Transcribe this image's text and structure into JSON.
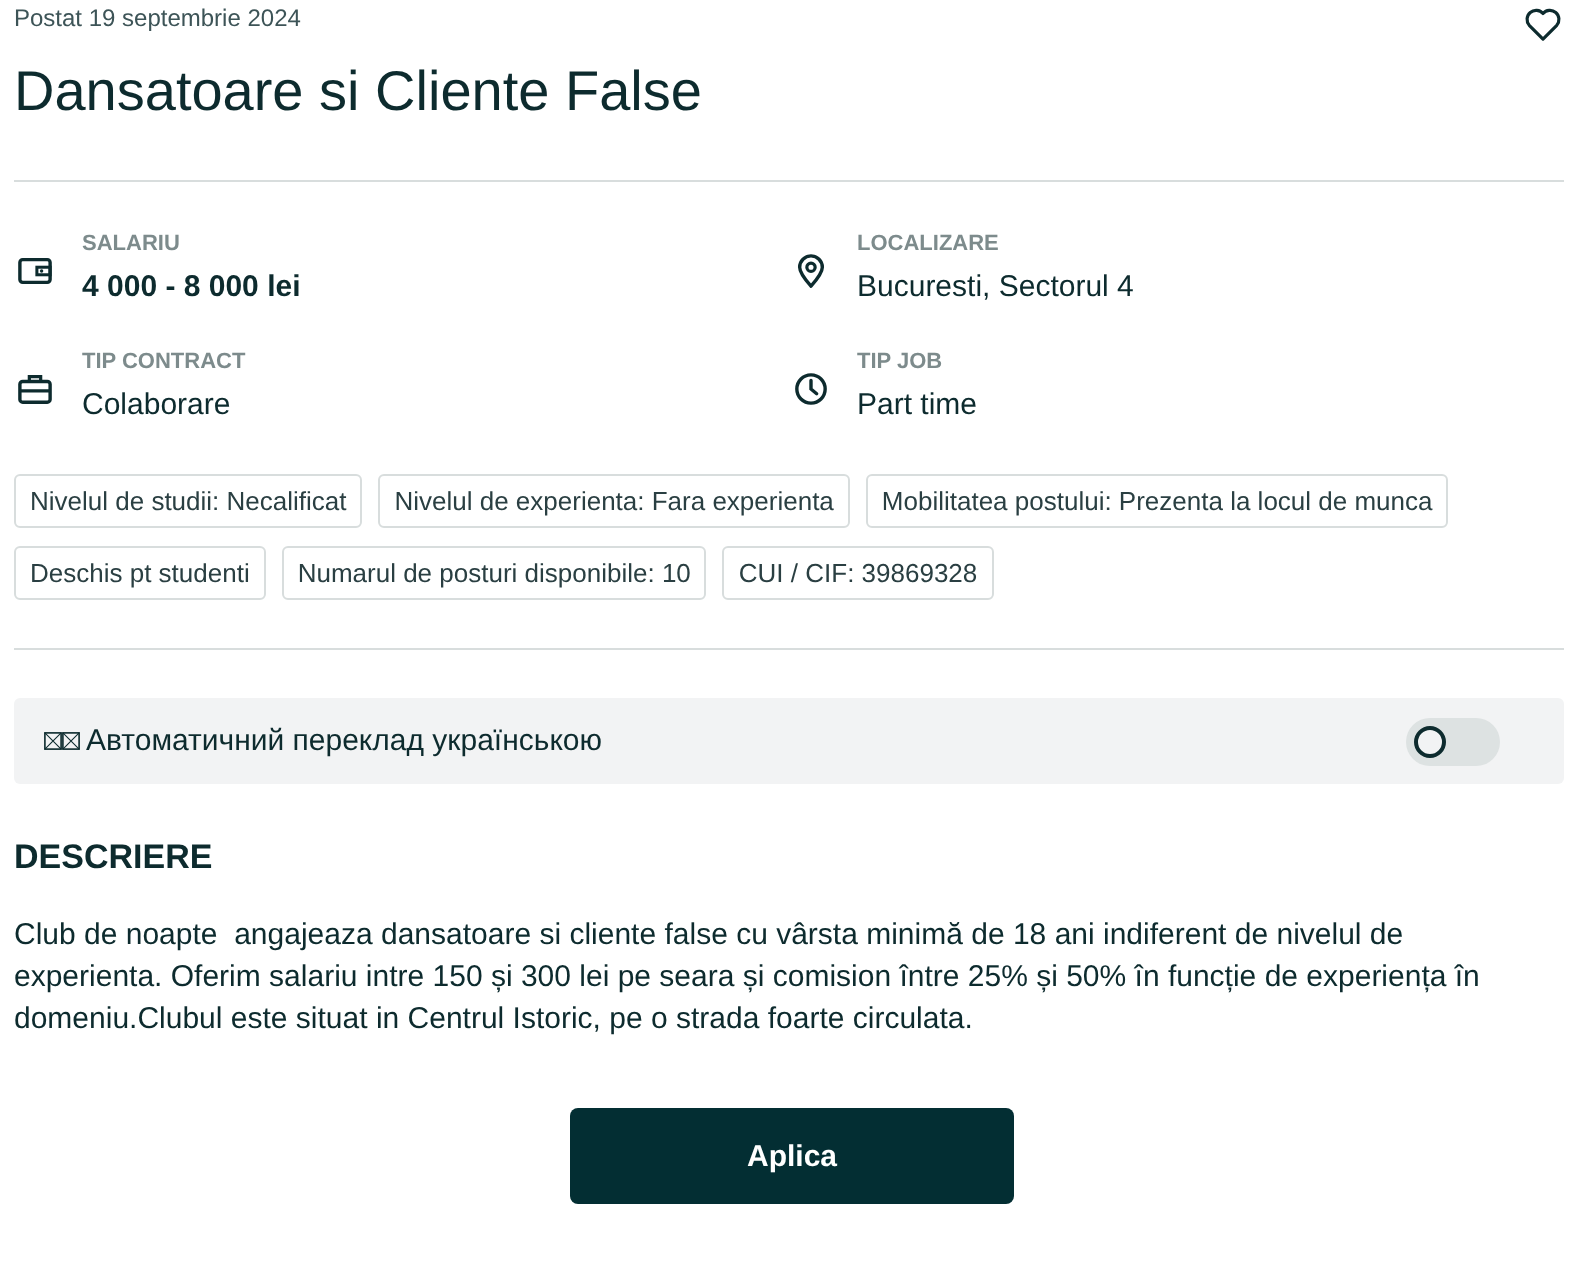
{
  "posted": "Postat 19 septembrie 2024",
  "title": "Dansatoare si Cliente False",
  "favorite": {
    "selected": false
  },
  "details": [
    {
      "label": "SALARIU",
      "value": "4 000 - 8 000 lei",
      "bold": true
    },
    {
      "label": "LOCALIZARE",
      "value": "Bucuresti, Sectorul 4",
      "bold": false
    },
    {
      "label": "TIP CONTRACT",
      "value": "Colaborare",
      "bold": false
    },
    {
      "label": "TIP JOB",
      "value": "Part time",
      "bold": false
    }
  ],
  "tags": [
    "Nivelul de studii: Necalificat",
    "Nivelul de experienta: Fara experienta",
    "Mobilitatea postului: Prezenta la locul de munca",
    "Deschis pt studenti",
    "Numarul de posturi disponibile: 10",
    "CUI / CIF: 39869328"
  ],
  "translation": {
    "label": "Автоматичний переклад українською",
    "on": false
  },
  "description": {
    "heading": "DESCRIERE",
    "text": "Club de noapte  angajeaza dansatoare si cliente false cu vârsta minimă de 18 ani indiferent de nivelul de experienta. Oferim salariu intre 150 și 300 lei pe seara și comision între 25% și 50% în funcție de experiența în domeniu.Clubul este situat in Centrul Istoric, pe o strada foarte circulata."
  },
  "apply_button": "Aplica"
}
